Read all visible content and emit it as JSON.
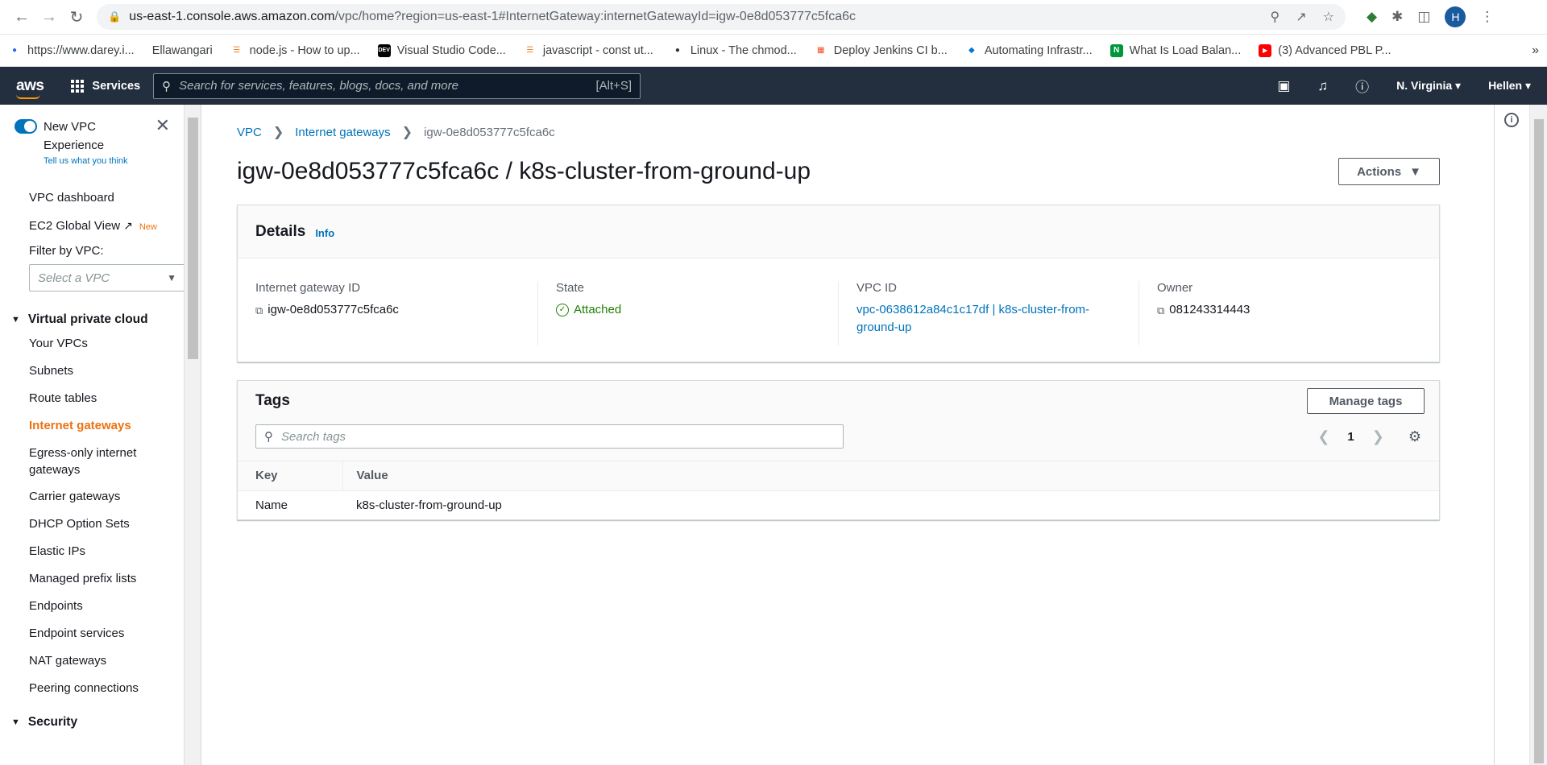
{
  "browser": {
    "url_host": "us-east-1.console.aws.amazon.com",
    "url_path": "/vpc/home?region=us-east-1#InternetGateway:internetGatewayId=igw-0e8d053777c5fca6c",
    "profile_initial": "H",
    "bookmarks": [
      {
        "label": "https://www.darey.i...",
        "icon": "darey-icon",
        "color": "#2d6cdf"
      },
      {
        "label": "Ellawangari",
        "icon": "",
        "color": ""
      },
      {
        "label": "node.js - How to up...",
        "icon": "stackoverflow-icon",
        "color": "#f48024"
      },
      {
        "label": "Visual Studio Code...",
        "icon": "dev-icon",
        "color": "#000000"
      },
      {
        "label": "javascript - const ut...",
        "icon": "stackoverflow-icon",
        "color": "#f48024"
      },
      {
        "label": "Linux - The chmod...",
        "icon": "globe-icon",
        "color": "#333333"
      },
      {
        "label": "Deploy Jenkins CI b...",
        "icon": "microsoft-icon",
        "color": "#f25022"
      },
      {
        "label": "Automating Infrastr...",
        "icon": "azure-icon",
        "color": "#0078d4"
      },
      {
        "label": "What Is Load Balan...",
        "icon": "nginx-icon",
        "color": "#009639"
      },
      {
        "label": "(3) Advanced PBL P...",
        "icon": "youtube-icon",
        "color": "#ff0000"
      }
    ]
  },
  "aws_nav": {
    "logo": "aws",
    "services_label": "Services",
    "search_placeholder": "Search for services, features, blogs, docs, and more",
    "search_shortcut": "[Alt+S]",
    "region": "N. Virginia",
    "user": "Hellen"
  },
  "sidebar": {
    "experience_title": "New VPC Experience",
    "experience_feedback": "Tell us what you think",
    "top_links": [
      {
        "label": "VPC dashboard"
      },
      {
        "label": "EC2 Global View",
        "badge": "New"
      }
    ],
    "filter_label": "Filter by VPC:",
    "filter_placeholder": "Select a VPC",
    "section_title": "Virtual private cloud",
    "links": [
      "Your VPCs",
      "Subnets",
      "Route tables",
      "Internet gateways",
      "Egress-only internet gateways",
      "Carrier gateways",
      "DHCP Option Sets",
      "Elastic IPs",
      "Managed prefix lists",
      "Endpoints",
      "Endpoint services",
      "NAT gateways",
      "Peering connections"
    ],
    "active_link": "Internet gateways",
    "section2_title": "Security"
  },
  "breadcrumb": {
    "items": [
      "VPC",
      "Internet gateways"
    ],
    "current": "igw-0e8d053777c5fca6c"
  },
  "page": {
    "title": "igw-0e8d053777c5fca6c / k8s-cluster-from-ground-up",
    "actions_label": "Actions"
  },
  "details": {
    "title": "Details",
    "info": "Info",
    "fields": {
      "igw_id_label": "Internet gateway ID",
      "igw_id_value": "igw-0e8d053777c5fca6c",
      "state_label": "State",
      "state_value": "Attached",
      "vpc_label": "VPC ID",
      "vpc_value": "vpc-0638612a84c1c17df | k8s-cluster-from-ground-up",
      "owner_label": "Owner",
      "owner_value": "081243314443"
    },
    "status_color": "#1d8102"
  },
  "tags": {
    "title": "Tags",
    "manage_label": "Manage tags",
    "search_placeholder": "Search tags",
    "page_number": "1",
    "columns": [
      "Key",
      "Value"
    ],
    "rows": [
      {
        "key": "Name",
        "value": "k8s-cluster-from-ground-up"
      }
    ]
  },
  "colors": {
    "aws_nav_bg": "#232f3e",
    "accent_orange": "#ec7211",
    "link_blue": "#0073bb"
  }
}
